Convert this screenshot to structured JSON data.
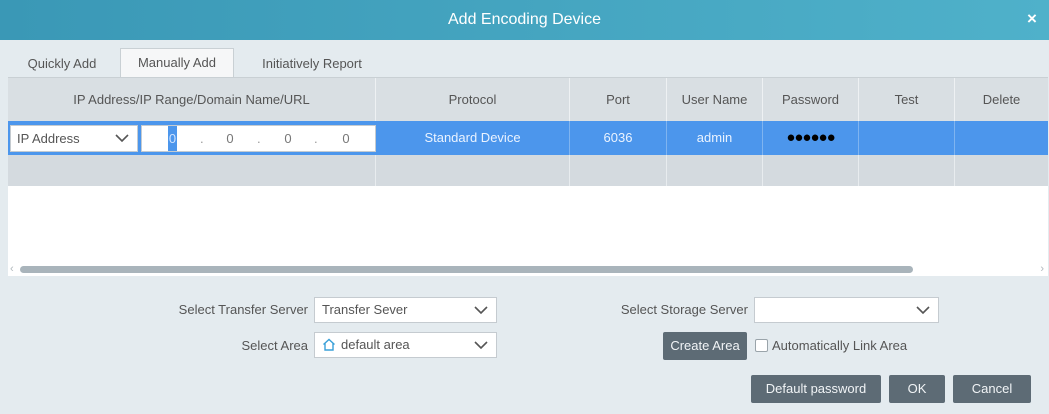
{
  "window": {
    "title": "Add Encoding Device",
    "close_glyph": "×"
  },
  "tabs": [
    {
      "label": "Quickly Add",
      "active": false
    },
    {
      "label": "Manually Add",
      "active": true
    },
    {
      "label": "Initiatively Report",
      "active": false
    }
  ],
  "grid": {
    "columns": [
      "IP Address/IP Range/Domain Name/URL",
      "Protocol",
      "Port",
      "User Name",
      "Password",
      "Test",
      "Delete"
    ],
    "rows": [
      {
        "address_type": "IP Address",
        "ip": [
          "0",
          "0",
          "0",
          "0"
        ],
        "protocol": "Standard Device",
        "port": "6036",
        "user_name": "admin",
        "password_mask": "●●●●●●",
        "test": "",
        "delete": ""
      }
    ]
  },
  "form": {
    "transfer_server_label": "Select Transfer Server",
    "transfer_server_value": "Transfer Sever",
    "storage_server_label": "Select Storage Server",
    "storage_server_value": "",
    "area_label": "Select Area",
    "area_value": "default area",
    "create_area_label": "Create Area",
    "auto_link_label": "Automatically Link Area",
    "auto_link_checked": false
  },
  "footer": {
    "default_password_label": "Default password",
    "ok_label": "OK",
    "cancel_label": "Cancel"
  },
  "icons": {
    "close": "close-icon",
    "dropdown": "chevron-down-icon",
    "area": "home-icon",
    "scroll_left": "arrow-left-icon",
    "scroll_right": "arrow-right-icon"
  },
  "colors": {
    "title_bar": "#3a98b6",
    "selected_row": "#4c96ec",
    "button": "#5d6b75",
    "panel_bg": "#e4ebef"
  }
}
